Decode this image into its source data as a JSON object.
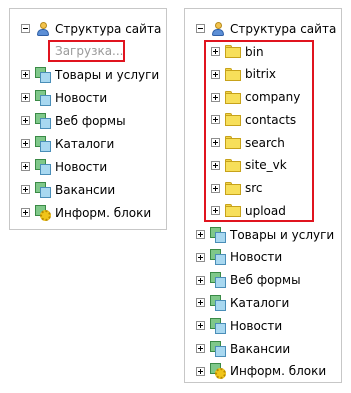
{
  "left_tree": {
    "root_label": "Структура сайта",
    "loading_text": "Загрузка...",
    "sections": [
      {
        "label": "Товары и услуги",
        "icon": "section-icon"
      },
      {
        "label": "Новости",
        "icon": "section-icon"
      },
      {
        "label": "Веб формы",
        "icon": "section-icon"
      },
      {
        "label": "Каталоги",
        "icon": "section-icon"
      },
      {
        "label": "Новости",
        "icon": "section-icon"
      },
      {
        "label": "Вакансии",
        "icon": "section-icon"
      },
      {
        "label": "Информ. блоки",
        "icon": "iblock-icon"
      }
    ]
  },
  "right_tree": {
    "root_label": "Структура сайта",
    "folders": [
      {
        "label": "bin"
      },
      {
        "label": "bitrix"
      },
      {
        "label": "company"
      },
      {
        "label": "contacts"
      },
      {
        "label": "search"
      },
      {
        "label": "site_vk"
      },
      {
        "label": "src"
      },
      {
        "label": "upload"
      }
    ],
    "sections": [
      {
        "label": "Товары и услуги",
        "icon": "section-icon"
      },
      {
        "label": "Новости",
        "icon": "section-icon"
      },
      {
        "label": "Веб формы",
        "icon": "section-icon"
      },
      {
        "label": "Каталоги",
        "icon": "section-icon"
      },
      {
        "label": "Новости",
        "icon": "section-icon"
      },
      {
        "label": "Вакансии",
        "icon": "section-icon"
      },
      {
        "label": "Информ. блоки",
        "icon": "iblock-icon"
      }
    ]
  },
  "highlight_color": "#e0141f"
}
